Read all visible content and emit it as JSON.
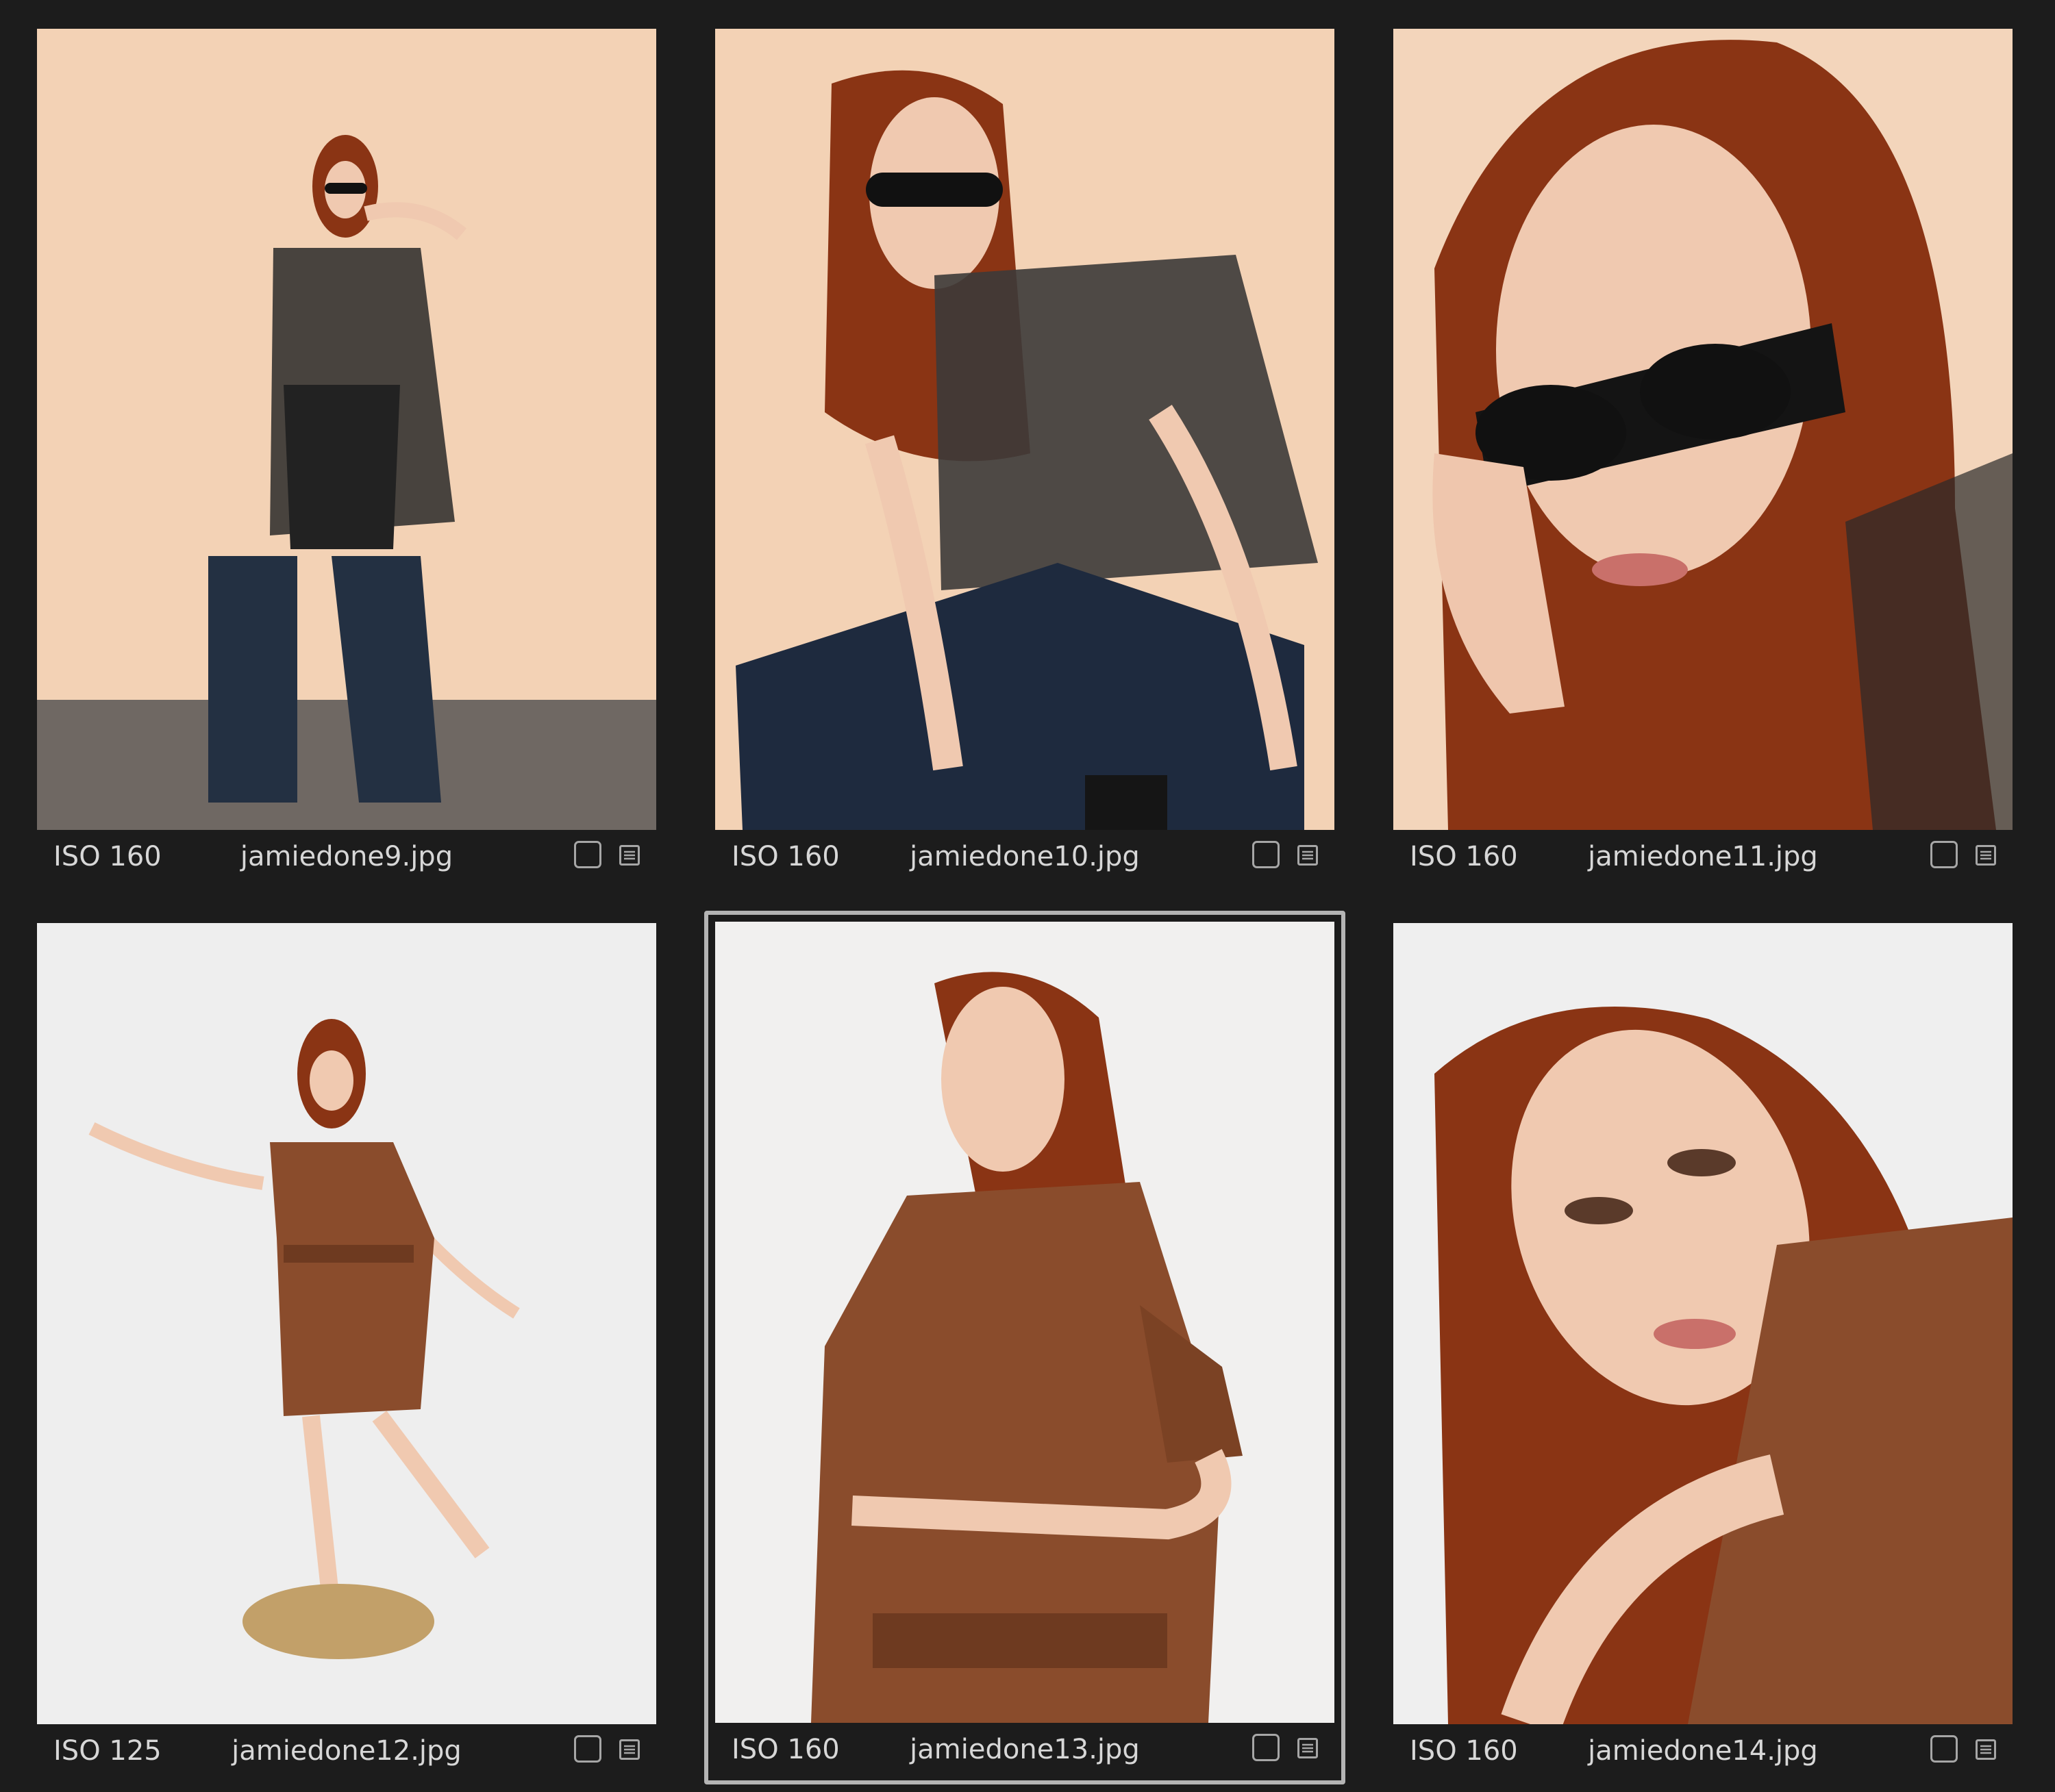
{
  "thumbnails": [
    {
      "iso": "ISO 160",
      "filename": "jamiedone9.jpg"
    },
    {
      "iso": "ISO 160",
      "filename": "jamiedone10.jpg"
    },
    {
      "iso": "ISO 160",
      "filename": "jamiedone11.jpg"
    },
    {
      "iso": "ISO 125",
      "filename": "jamiedone12.jpg"
    },
    {
      "iso": "ISO 160",
      "filename": "jamiedone13.jpg",
      "selected": true
    },
    {
      "iso": "ISO 160",
      "filename": "jamiedone14.jpg"
    }
  ],
  "colors": {
    "background": "#1c1c1c",
    "selection_border": "#b4b4b4",
    "label_text": "#d7d7d7",
    "warm_backdrop": "#f3d2b5",
    "white_backdrop": "#eeeeee",
    "hair": "#8a3414",
    "leather": "#8a4c2c"
  },
  "icons": [
    "select-checkbox-icon",
    "metadata-list-icon"
  ]
}
